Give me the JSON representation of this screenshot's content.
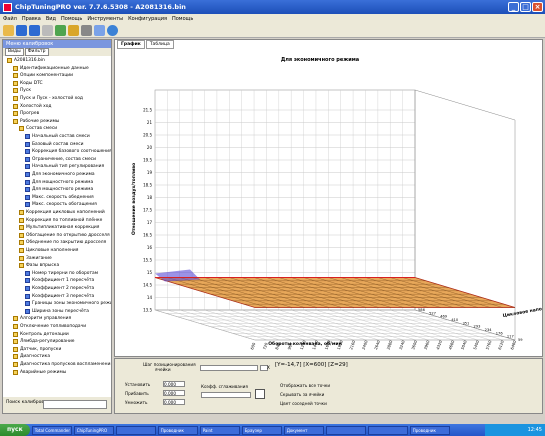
{
  "window": {
    "title": "ChipTuningPRO ver. 7.7.6.5308 - A2081316.bin"
  },
  "menu": [
    "Файл",
    "Правка",
    "Вид",
    "Помощь",
    "Инструменты",
    "Конфигурация",
    "Помощь"
  ],
  "left_panel": {
    "header": "Меню калибровок",
    "tabs": [
      "Виды",
      "Фильтр"
    ],
    "tree": [
      {
        "label": "A2081316.bin",
        "icon": "file-icon",
        "indent": 0
      },
      {
        "label": "Идентификационные данные",
        "icon": "folder-icon",
        "indent": 1
      },
      {
        "label": "Опции компонентации",
        "icon": "folder-icon",
        "indent": 1
      },
      {
        "label": "Коды DTC",
        "icon": "folder-icon",
        "indent": 1
      },
      {
        "label": "Пуск",
        "icon": "folder-icon",
        "indent": 1
      },
      {
        "label": "Пуск и Пуск - холостой ход",
        "icon": "folder-icon",
        "indent": 1
      },
      {
        "label": "Холостой ход",
        "icon": "folder-icon",
        "indent": 1
      },
      {
        "label": "Прогрев",
        "icon": "folder-icon",
        "indent": 1
      },
      {
        "label": "Рабочие режимы",
        "icon": "folder-icon",
        "indent": 1
      },
      {
        "label": "Состав смеси",
        "icon": "folder-icon",
        "indent": 2
      },
      {
        "label": "Начальный состав смеси",
        "icon": "table-icon",
        "indent": 3
      },
      {
        "label": "Базовый состав смеси",
        "icon": "table-icon",
        "indent": 3
      },
      {
        "label": "Коррекция базового соотношения",
        "icon": "table-icon",
        "indent": 3
      },
      {
        "label": "Ограничение, состав смеси",
        "icon": "table-icon",
        "indent": 3
      },
      {
        "label": "Начальный тип регулирования",
        "icon": "table-icon",
        "indent": 3
      },
      {
        "label": "Для экономичного режима",
        "icon": "table-icon",
        "indent": 3
      },
      {
        "label": "Для мощностного режима",
        "icon": "table-icon",
        "indent": 3
      },
      {
        "label": "Для мощностного режима",
        "icon": "table-icon",
        "indent": 3
      },
      {
        "label": "Макс. скорость обеднения",
        "icon": "table-icon",
        "indent": 3
      },
      {
        "label": "Макс. скорость обогащения",
        "icon": "table-icon",
        "indent": 3
      },
      {
        "label": "Коррекция цикловых наполнений",
        "icon": "folder-icon",
        "indent": 2
      },
      {
        "label": "Коррекция по топливной плёнке",
        "icon": "folder-icon",
        "indent": 2
      },
      {
        "label": "Мультипликативная коррекция",
        "icon": "folder-icon",
        "indent": 2
      },
      {
        "label": "Обогащение по открытию дросселя",
        "icon": "folder-icon",
        "indent": 2
      },
      {
        "label": "Обеднение по закрытию дросселя",
        "icon": "folder-icon",
        "indent": 2
      },
      {
        "label": "Цикловые наполнения",
        "icon": "folder-icon",
        "indent": 2
      },
      {
        "label": "Зажигание",
        "icon": "folder-icon",
        "indent": 2
      },
      {
        "label": "Фазы впрыска",
        "icon": "folder-icon",
        "indent": 2
      },
      {
        "label": "Номер тирерни по оборотам",
        "icon": "table-icon",
        "indent": 3
      },
      {
        "label": "Коэффициент 1 пересчёта",
        "icon": "table-icon",
        "indent": 3
      },
      {
        "label": "Коэффициент 2 пересчёта",
        "icon": "table-icon",
        "indent": 3
      },
      {
        "label": "Коэффициент 3 пересчёта",
        "icon": "table-icon",
        "indent": 3
      },
      {
        "label": "Границы зоны экономичного режима",
        "icon": "table-icon",
        "indent": 3
      },
      {
        "label": "Ширина зоны пересчёта",
        "icon": "table-icon",
        "indent": 3
      },
      {
        "label": "Алгоритм управления",
        "icon": "folder-icon",
        "indent": 1
      },
      {
        "label": "Отключение топливоподачи",
        "icon": "folder-icon",
        "indent": 1
      },
      {
        "label": "Контроль детонации",
        "icon": "folder-icon",
        "indent": 1
      },
      {
        "label": "Лямбда-регулирование",
        "icon": "folder-icon",
        "indent": 1
      },
      {
        "label": "Датчик, пропуски",
        "icon": "folder-icon",
        "indent": 1
      },
      {
        "label": "Диагностика",
        "icon": "folder-icon",
        "indent": 1
      },
      {
        "label": "Диагностика пропусков воспламенения",
        "icon": "folder-icon",
        "indent": 1
      },
      {
        "label": "Аварийные режимы",
        "icon": "folder-icon",
        "indent": 1
      }
    ],
    "search_label": "Поиск калибровок",
    "search_value": ""
  },
  "right_panel": {
    "tabs": [
      "График",
      "Таблица"
    ],
    "active_tab": "График"
  },
  "chart_data": {
    "type": "surface",
    "title": "Для экономичного режима",
    "xlabel": "Обороты коленвала, об/мин",
    "ylabel": "Отношение воздух/топливо",
    "zlabel": "Цикловое наполнение",
    "x_ticks": [
      "600",
      "720",
      "840",
      "960",
      "1200",
      "1440",
      "1680",
      "1920",
      "2160",
      "2400",
      "2640",
      "2880",
      "3240",
      "3600",
      "3960",
      "4320",
      "4680",
      "5040",
      "5400",
      "5760",
      "6120",
      "6480"
    ],
    "y_ticks": [
      "13.5",
      "14",
      "14.5",
      "15",
      "15.5",
      "16",
      "16.5",
      "17",
      "17.5",
      "18",
      "18.5",
      "19",
      "19.5",
      "20",
      "20.5",
      "21",
      "21.5"
    ],
    "z_ticks": [
      "59",
      "117",
      "176",
      "234",
      "293",
      "351",
      "410",
      "469",
      "527",
      "586"
    ],
    "surface_value_range": [
      14.7,
      14.9
    ],
    "grid": true,
    "colors": {
      "surface": "#e8a85a",
      "mesh": "#7a4a1a",
      "highlight": "#5a4ad6",
      "edge": "#d82020"
    }
  },
  "bottom": {
    "slider_label": "Шаг позиционирования",
    "slider_sub": "ячейки",
    "x_checkbox": "X",
    "readout": "[Y=-14,7] [X=600] [Z=29]",
    "fields": [
      {
        "label": "Установить",
        "value": "0.000"
      },
      {
        "label": "Прибавить",
        "value": "0.000"
      },
      {
        "label": "Умножить",
        "value": "0.000"
      }
    ],
    "coef_label": "Коэфф. сглаживания",
    "options": [
      "Отображать все точки",
      "Скрывать за ячейки",
      "Цвет соседней точки"
    ]
  },
  "taskbar": {
    "start": "пуск",
    "tasks": [
      "Total Commander",
      "ChipTuningPRO",
      "",
      "Проводник",
      "Paint",
      "Браузер",
      "Документ",
      "",
      "",
      "Проводник"
    ],
    "tray_time": "12:45"
  }
}
